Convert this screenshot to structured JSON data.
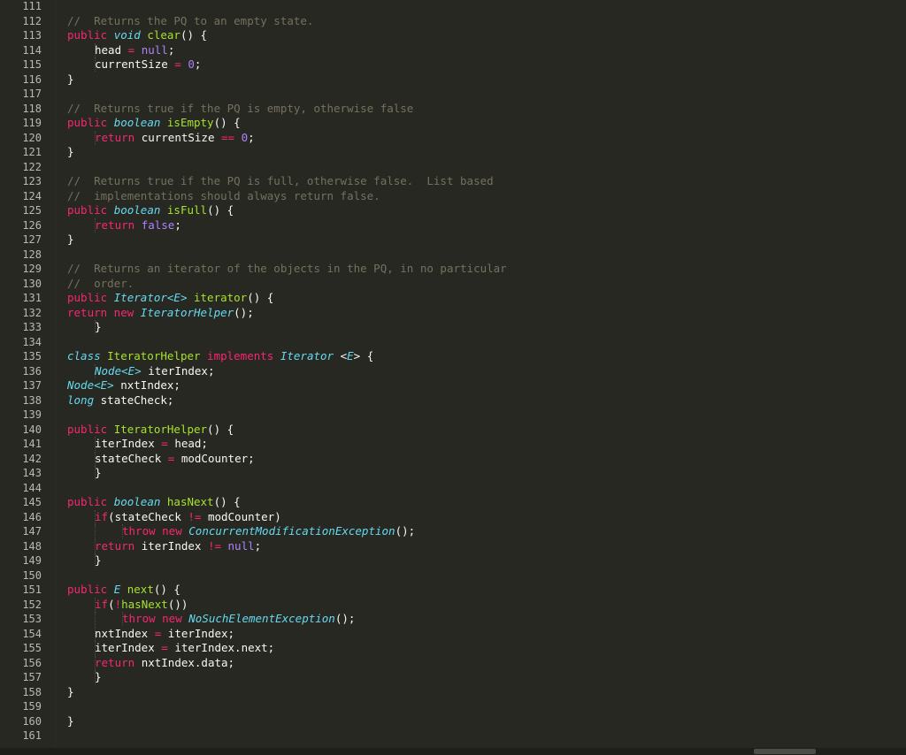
{
  "editor": {
    "theme_colors": {
      "background": "#272822",
      "plain": "#f8f8f2",
      "keyword": "#f92672",
      "type": "#66d9ef",
      "function": "#a6e22e",
      "number": "#ae81ff",
      "comment": "#75715e",
      "line_number": "#b9b9b1"
    },
    "lines": [
      {
        "n": "111",
        "indent": 0,
        "tokens": []
      },
      {
        "n": "112",
        "indent": 1,
        "tokens": [
          [
            "com",
            "//  Returns the PQ to an empty state."
          ]
        ]
      },
      {
        "n": "113",
        "indent": 1,
        "tokens": [
          [
            "kw",
            "public "
          ],
          [
            "type",
            "void "
          ],
          [
            "fn",
            "clear"
          ],
          [
            "plain",
            "() {"
          ]
        ]
      },
      {
        "n": "114",
        "indent": 2,
        "tokens": [
          [
            "plain",
            "head "
          ],
          [
            "kw",
            "= "
          ],
          [
            "const",
            "null"
          ],
          [
            "plain",
            ";"
          ]
        ]
      },
      {
        "n": "115",
        "indent": 2,
        "tokens": [
          [
            "plain",
            "currentSize "
          ],
          [
            "kw",
            "= "
          ],
          [
            "num",
            "0"
          ],
          [
            "plain",
            ";"
          ]
        ]
      },
      {
        "n": "116",
        "indent": 1,
        "tokens": [
          [
            "plain",
            "}"
          ]
        ]
      },
      {
        "n": "117",
        "indent": 0,
        "tokens": []
      },
      {
        "n": "118",
        "indent": 1,
        "tokens": [
          [
            "com",
            "//  Returns true if the PQ is empty, otherwise false"
          ]
        ]
      },
      {
        "n": "119",
        "indent": 1,
        "tokens": [
          [
            "kw",
            "public "
          ],
          [
            "type",
            "boolean "
          ],
          [
            "fn",
            "isEmpty"
          ],
          [
            "plain",
            "() {"
          ]
        ]
      },
      {
        "n": "120",
        "indent": 2,
        "tokens": [
          [
            "kw",
            "return "
          ],
          [
            "plain",
            "currentSize "
          ],
          [
            "kw",
            "== "
          ],
          [
            "num",
            "0"
          ],
          [
            "plain",
            ";"
          ]
        ]
      },
      {
        "n": "121",
        "indent": 1,
        "tokens": [
          [
            "plain",
            "}"
          ]
        ]
      },
      {
        "n": "122",
        "indent": 0,
        "tokens": []
      },
      {
        "n": "123",
        "indent": 1,
        "tokens": [
          [
            "com",
            "//  Returns true if the PQ is full, otherwise false.  List based"
          ]
        ]
      },
      {
        "n": "124",
        "indent": 1,
        "tokens": [
          [
            "com",
            "//  implementations should always return false."
          ]
        ]
      },
      {
        "n": "125",
        "indent": 1,
        "tokens": [
          [
            "kw",
            "public "
          ],
          [
            "type",
            "boolean "
          ],
          [
            "fn",
            "isFull"
          ],
          [
            "plain",
            "() {"
          ]
        ]
      },
      {
        "n": "126",
        "indent": 2,
        "tokens": [
          [
            "kw",
            "return "
          ],
          [
            "const",
            "false"
          ],
          [
            "plain",
            ";"
          ]
        ]
      },
      {
        "n": "127",
        "indent": 1,
        "tokens": [
          [
            "plain",
            "}"
          ]
        ]
      },
      {
        "n": "128",
        "indent": 0,
        "tokens": []
      },
      {
        "n": "129",
        "indent": 1,
        "tokens": [
          [
            "com",
            "//  Returns an iterator of the objects in the PQ, in no particular"
          ]
        ]
      },
      {
        "n": "130",
        "indent": 1,
        "tokens": [
          [
            "com",
            "//  order."
          ]
        ]
      },
      {
        "n": "131",
        "indent": 1,
        "tokens": [
          [
            "kw",
            "public "
          ],
          [
            "type",
            "Iterator<E> "
          ],
          [
            "fn",
            "iterator"
          ],
          [
            "plain",
            "() {"
          ]
        ]
      },
      {
        "n": "132",
        "indent": 1,
        "tokens": [
          [
            "kw",
            "return new "
          ],
          [
            "type",
            "IteratorHelper"
          ],
          [
            "plain",
            "();"
          ]
        ]
      },
      {
        "n": "133",
        "indent": 2,
        "tokens": [
          [
            "plain",
            "}"
          ]
        ]
      },
      {
        "n": "134",
        "indent": 0,
        "tokens": []
      },
      {
        "n": "135",
        "indent": 1,
        "tokens": [
          [
            "type",
            "class "
          ],
          [
            "fn",
            "IteratorHelper "
          ],
          [
            "kw",
            "implements "
          ],
          [
            "type",
            "Iterator "
          ],
          [
            "plain",
            "<"
          ],
          [
            "type",
            "E"
          ],
          [
            "plain",
            "> {"
          ]
        ]
      },
      {
        "n": "136",
        "indent": 2,
        "tokens": [
          [
            "type",
            "Node<E> "
          ],
          [
            "plain",
            "iterIndex;"
          ]
        ]
      },
      {
        "n": "137",
        "indent": 1,
        "tokens": [
          [
            "type",
            "Node<E> "
          ],
          [
            "plain",
            "nxtIndex;"
          ]
        ]
      },
      {
        "n": "138",
        "indent": 1,
        "tokens": [
          [
            "type",
            "long "
          ],
          [
            "plain",
            "stateCheck;"
          ]
        ]
      },
      {
        "n": "139",
        "indent": 0,
        "tokens": []
      },
      {
        "n": "140",
        "indent": 1,
        "tokens": [
          [
            "kw",
            "public "
          ],
          [
            "fn",
            "IteratorHelper"
          ],
          [
            "plain",
            "() {"
          ]
        ]
      },
      {
        "n": "141",
        "indent": 2,
        "tokens": [
          [
            "plain",
            "iterIndex "
          ],
          [
            "kw",
            "= "
          ],
          [
            "plain",
            "head;"
          ]
        ]
      },
      {
        "n": "142",
        "indent": 2,
        "tokens": [
          [
            "plain",
            "stateCheck "
          ],
          [
            "kw",
            "= "
          ],
          [
            "plain",
            "modCounter;"
          ]
        ]
      },
      {
        "n": "143",
        "indent": 2,
        "tokens": [
          [
            "plain",
            "}"
          ]
        ]
      },
      {
        "n": "144",
        "indent": 0,
        "tokens": []
      },
      {
        "n": "145",
        "indent": 1,
        "tokens": [
          [
            "kw",
            "public "
          ],
          [
            "type",
            "boolean "
          ],
          [
            "fn",
            "hasNext"
          ],
          [
            "plain",
            "() {"
          ]
        ]
      },
      {
        "n": "146",
        "indent": 2,
        "tokens": [
          [
            "kw",
            "if"
          ],
          [
            "plain",
            "(stateCheck "
          ],
          [
            "kw",
            "!= "
          ],
          [
            "plain",
            "modCounter)"
          ]
        ]
      },
      {
        "n": "147",
        "indent": 3,
        "tokens": [
          [
            "kw",
            "throw new "
          ],
          [
            "type",
            "ConcurrentModificationException"
          ],
          [
            "plain",
            "();"
          ]
        ]
      },
      {
        "n": "148",
        "indent": 2,
        "tokens": [
          [
            "kw",
            "return "
          ],
          [
            "plain",
            "iterIndex "
          ],
          [
            "kw",
            "!= "
          ],
          [
            "const",
            "null"
          ],
          [
            "plain",
            ";"
          ]
        ]
      },
      {
        "n": "149",
        "indent": 2,
        "tokens": [
          [
            "plain",
            "}"
          ]
        ]
      },
      {
        "n": "150",
        "indent": 0,
        "tokens": []
      },
      {
        "n": "151",
        "indent": 1,
        "tokens": [
          [
            "kw",
            "public "
          ],
          [
            "type",
            "E "
          ],
          [
            "fn",
            "next"
          ],
          [
            "plain",
            "() {"
          ]
        ]
      },
      {
        "n": "152",
        "indent": 2,
        "tokens": [
          [
            "kw",
            "if"
          ],
          [
            "plain",
            "("
          ],
          [
            "kw",
            "!"
          ],
          [
            "fn",
            "hasNext"
          ],
          [
            "plain",
            "())"
          ]
        ]
      },
      {
        "n": "153",
        "indent": 3,
        "tokens": [
          [
            "kw",
            "throw new "
          ],
          [
            "type",
            "NoSuchElementException"
          ],
          [
            "plain",
            "();"
          ]
        ]
      },
      {
        "n": "154",
        "indent": 2,
        "tokens": [
          [
            "plain",
            "nxtIndex "
          ],
          [
            "kw",
            "= "
          ],
          [
            "plain",
            "iterIndex;"
          ]
        ]
      },
      {
        "n": "155",
        "indent": 2,
        "tokens": [
          [
            "plain",
            "iterIndex "
          ],
          [
            "kw",
            "= "
          ],
          [
            "plain",
            "iterIndex.next;"
          ]
        ]
      },
      {
        "n": "156",
        "indent": 2,
        "tokens": [
          [
            "kw",
            "return "
          ],
          [
            "plain",
            "nxtIndex.data;"
          ]
        ]
      },
      {
        "n": "157",
        "indent": 2,
        "tokens": [
          [
            "plain",
            "}"
          ]
        ]
      },
      {
        "n": "158",
        "indent": 1,
        "tokens": [
          [
            "plain",
            "}"
          ]
        ]
      },
      {
        "n": "159",
        "indent": 0,
        "tokens": []
      },
      {
        "n": "160",
        "indent": 0,
        "tokens": [
          [
            "plain",
            "}"
          ]
        ]
      },
      {
        "n": "161",
        "indent": 0,
        "tokens": []
      }
    ]
  }
}
